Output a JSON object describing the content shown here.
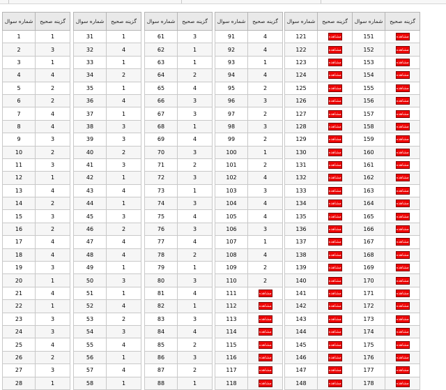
{
  "header": {
    "col_answer": "گزینه صحیح",
    "col_question": "شماره سوال"
  },
  "show_label": "مشاهده",
  "colors": {
    "show_button": "#ee0000",
    "header_bg": "#e9e9e9"
  },
  "blocks": [
    {
      "rows": [
        {
          "q": "1",
          "a": "1"
        },
        {
          "q": "2",
          "a": "3"
        },
        {
          "q": "3",
          "a": "1"
        },
        {
          "q": "4",
          "a": "4"
        },
        {
          "q": "5",
          "a": "2"
        },
        {
          "q": "6",
          "a": "2"
        },
        {
          "q": "7",
          "a": "4"
        },
        {
          "q": "8",
          "a": "4"
        },
        {
          "q": "9",
          "a": "3"
        },
        {
          "q": "10",
          "a": "2"
        },
        {
          "q": "11",
          "a": "3"
        },
        {
          "q": "12",
          "a": "1"
        },
        {
          "q": "13",
          "a": "4"
        },
        {
          "q": "14",
          "a": "2"
        },
        {
          "q": "15",
          "a": "3"
        },
        {
          "q": "16",
          "a": "2"
        },
        {
          "q": "17",
          "a": "4"
        },
        {
          "q": "18",
          "a": "4"
        },
        {
          "q": "19",
          "a": "3"
        },
        {
          "q": "20",
          "a": "1"
        },
        {
          "q": "21",
          "a": "4"
        },
        {
          "q": "22",
          "a": "1"
        },
        {
          "q": "23",
          "a": "3"
        },
        {
          "q": "24",
          "a": "3"
        },
        {
          "q": "25",
          "a": "4"
        },
        {
          "q": "26",
          "a": "2"
        },
        {
          "q": "27",
          "a": "3"
        },
        {
          "q": "28",
          "a": "1"
        }
      ]
    },
    {
      "rows": [
        {
          "q": "31",
          "a": "1"
        },
        {
          "q": "32",
          "a": "4"
        },
        {
          "q": "33",
          "a": "1"
        },
        {
          "q": "34",
          "a": "2"
        },
        {
          "q": "35",
          "a": "1"
        },
        {
          "q": "36",
          "a": "4"
        },
        {
          "q": "37",
          "a": "1"
        },
        {
          "q": "38",
          "a": "3"
        },
        {
          "q": "39",
          "a": "3"
        },
        {
          "q": "40",
          "a": "2"
        },
        {
          "q": "41",
          "a": "3"
        },
        {
          "q": "42",
          "a": "1"
        },
        {
          "q": "43",
          "a": "4"
        },
        {
          "q": "44",
          "a": "1"
        },
        {
          "q": "45",
          "a": "3"
        },
        {
          "q": "46",
          "a": "2"
        },
        {
          "q": "47",
          "a": "4"
        },
        {
          "q": "48",
          "a": "4"
        },
        {
          "q": "49",
          "a": "1"
        },
        {
          "q": "50",
          "a": "3"
        },
        {
          "q": "51",
          "a": "1"
        },
        {
          "q": "52",
          "a": "4"
        },
        {
          "q": "53",
          "a": "2"
        },
        {
          "q": "54",
          "a": "3"
        },
        {
          "q": "55",
          "a": "4"
        },
        {
          "q": "56",
          "a": "1"
        },
        {
          "q": "57",
          "a": "4"
        },
        {
          "q": "58",
          "a": "1"
        }
      ]
    },
    {
      "rows": [
        {
          "q": "61",
          "a": "3"
        },
        {
          "q": "62",
          "a": "1"
        },
        {
          "q": "63",
          "a": "1"
        },
        {
          "q": "64",
          "a": "2"
        },
        {
          "q": "65",
          "a": "4"
        },
        {
          "q": "66",
          "a": "3"
        },
        {
          "q": "67",
          "a": "3"
        },
        {
          "q": "68",
          "a": "1"
        },
        {
          "q": "69",
          "a": "4"
        },
        {
          "q": "70",
          "a": "3"
        },
        {
          "q": "71",
          "a": "2"
        },
        {
          "q": "72",
          "a": "3"
        },
        {
          "q": "73",
          "a": "1"
        },
        {
          "q": "74",
          "a": "3"
        },
        {
          "q": "75",
          "a": "4"
        },
        {
          "q": "76",
          "a": "3"
        },
        {
          "q": "77",
          "a": "4"
        },
        {
          "q": "78",
          "a": "2"
        },
        {
          "q": "79",
          "a": "1"
        },
        {
          "q": "80",
          "a": "3"
        },
        {
          "q": "81",
          "a": "4"
        },
        {
          "q": "82",
          "a": "1"
        },
        {
          "q": "83",
          "a": "3"
        },
        {
          "q": "84",
          "a": "4"
        },
        {
          "q": "85",
          "a": "2"
        },
        {
          "q": "86",
          "a": "3"
        },
        {
          "q": "87",
          "a": "2"
        },
        {
          "q": "88",
          "a": "1"
        }
      ]
    },
    {
      "rows": [
        {
          "q": "91",
          "a": "4"
        },
        {
          "q": "92",
          "a": "4"
        },
        {
          "q": "93",
          "a": "1"
        },
        {
          "q": "94",
          "a": "4"
        },
        {
          "q": "95",
          "a": "2"
        },
        {
          "q": "96",
          "a": "3"
        },
        {
          "q": "97",
          "a": "2"
        },
        {
          "q": "98",
          "a": "3"
        },
        {
          "q": "99",
          "a": "2"
        },
        {
          "q": "100",
          "a": "1"
        },
        {
          "q": "101",
          "a": "2"
        },
        {
          "q": "102",
          "a": "4"
        },
        {
          "q": "103",
          "a": "3"
        },
        {
          "q": "104",
          "a": "4"
        },
        {
          "q": "105",
          "a": "4"
        },
        {
          "q": "106",
          "a": "3"
        },
        {
          "q": "107",
          "a": "1"
        },
        {
          "q": "108",
          "a": "4"
        },
        {
          "q": "109",
          "a": "2"
        },
        {
          "q": "110",
          "a": "2"
        },
        {
          "q": "111",
          "a": null
        },
        {
          "q": "112",
          "a": null
        },
        {
          "q": "113",
          "a": null
        },
        {
          "q": "114",
          "a": null
        },
        {
          "q": "115",
          "a": null
        },
        {
          "q": "116",
          "a": null
        },
        {
          "q": "117",
          "a": null
        },
        {
          "q": "118",
          "a": null
        }
      ]
    },
    {
      "rows": [
        {
          "q": "121",
          "a": null
        },
        {
          "q": "122",
          "a": null
        },
        {
          "q": "123",
          "a": null
        },
        {
          "q": "124",
          "a": null
        },
        {
          "q": "125",
          "a": null
        },
        {
          "q": "126",
          "a": null
        },
        {
          "q": "127",
          "a": null
        },
        {
          "q": "128",
          "a": null
        },
        {
          "q": "129",
          "a": null
        },
        {
          "q": "130",
          "a": null
        },
        {
          "q": "131",
          "a": null
        },
        {
          "q": "132",
          "a": null
        },
        {
          "q": "133",
          "a": null
        },
        {
          "q": "134",
          "a": null
        },
        {
          "q": "135",
          "a": null
        },
        {
          "q": "136",
          "a": null
        },
        {
          "q": "137",
          "a": null
        },
        {
          "q": "138",
          "a": null
        },
        {
          "q": "139",
          "a": null
        },
        {
          "q": "140",
          "a": null
        },
        {
          "q": "141",
          "a": null
        },
        {
          "q": "142",
          "a": null
        },
        {
          "q": "143",
          "a": null
        },
        {
          "q": "144",
          "a": null
        },
        {
          "q": "145",
          "a": null
        },
        {
          "q": "146",
          "a": null
        },
        {
          "q": "147",
          "a": null
        },
        {
          "q": "148",
          "a": null
        }
      ]
    },
    {
      "rows": [
        {
          "q": "151",
          "a": null
        },
        {
          "q": "152",
          "a": null
        },
        {
          "q": "153",
          "a": null
        },
        {
          "q": "154",
          "a": null
        },
        {
          "q": "155",
          "a": null
        },
        {
          "q": "156",
          "a": null
        },
        {
          "q": "157",
          "a": null
        },
        {
          "q": "158",
          "a": null
        },
        {
          "q": "159",
          "a": null
        },
        {
          "q": "160",
          "a": null
        },
        {
          "q": "161",
          "a": null
        },
        {
          "q": "162",
          "a": null
        },
        {
          "q": "163",
          "a": null
        },
        {
          "q": "164",
          "a": null
        },
        {
          "q": "165",
          "a": null
        },
        {
          "q": "166",
          "a": null
        },
        {
          "q": "167",
          "a": null
        },
        {
          "q": "168",
          "a": null
        },
        {
          "q": "169",
          "a": null
        },
        {
          "q": "170",
          "a": null
        },
        {
          "q": "171",
          "a": null
        },
        {
          "q": "172",
          "a": null
        },
        {
          "q": "173",
          "a": null
        },
        {
          "q": "174",
          "a": null
        },
        {
          "q": "175",
          "a": null
        },
        {
          "q": "176",
          "a": null
        },
        {
          "q": "177",
          "a": null
        },
        {
          "q": "178",
          "a": null
        }
      ]
    }
  ]
}
